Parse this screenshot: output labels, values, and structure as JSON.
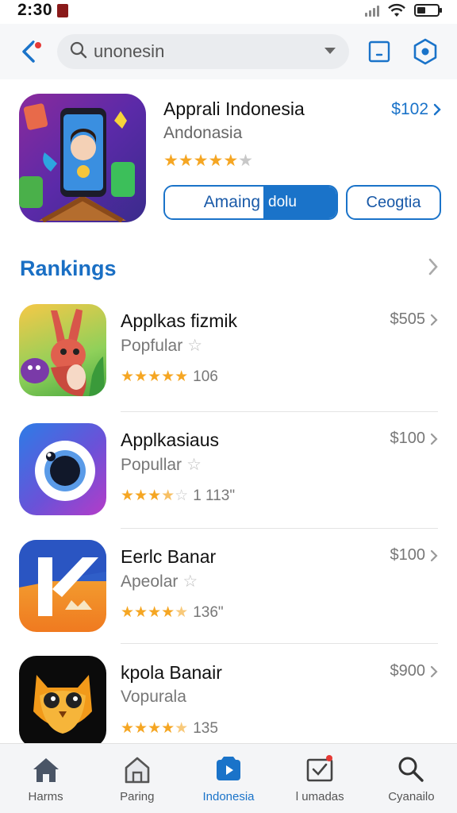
{
  "status_bar": {
    "time": "2:30"
  },
  "search": {
    "query": "unonesin"
  },
  "featured": {
    "title": "Apprali Indonesia",
    "subtitle": "Andonasia",
    "rating_stars": 4.5,
    "price": "$102",
    "primary_button_left": "Amaing",
    "primary_button_right": "dolu",
    "secondary_button": "Ceogtia"
  },
  "rankings": {
    "title": "Rankings",
    "items": [
      {
        "name": "Applkas fizmik",
        "category": "Popfular",
        "rating_stars": 5,
        "count": "106",
        "price": "$505",
        "icon": "rabbit-app-icon"
      },
      {
        "name": "Applkasiaus",
        "category": "Popullar",
        "rating_stars": 3.5,
        "count": "1 113\"",
        "price": "$100",
        "icon": "camera-lens-app-icon"
      },
      {
        "name": "Eerlc Banar",
        "category": "Apeolar",
        "rating_stars": 4.5,
        "count": "136\"",
        "price": "$100",
        "icon": "k-letter-app-icon"
      },
      {
        "name": "kpola Banair",
        "category": "Vopurala",
        "rating_stars": 4.5,
        "count": "135",
        "price": "$900",
        "icon": "owl-app-icon"
      }
    ]
  },
  "bottom_nav": [
    {
      "label": "Harms",
      "icon": "home-icon",
      "active": false
    },
    {
      "label": "Paring",
      "icon": "house-outline-icon",
      "active": false
    },
    {
      "label": "Indonesia",
      "icon": "play-tab-icon",
      "active": true
    },
    {
      "label": "l umadas",
      "icon": "updates-icon",
      "active": false
    },
    {
      "label": "Cyanailo",
      "icon": "search-icon",
      "active": false
    }
  ],
  "colors": {
    "accent": "#1a73c9",
    "star": "#f5a623"
  }
}
